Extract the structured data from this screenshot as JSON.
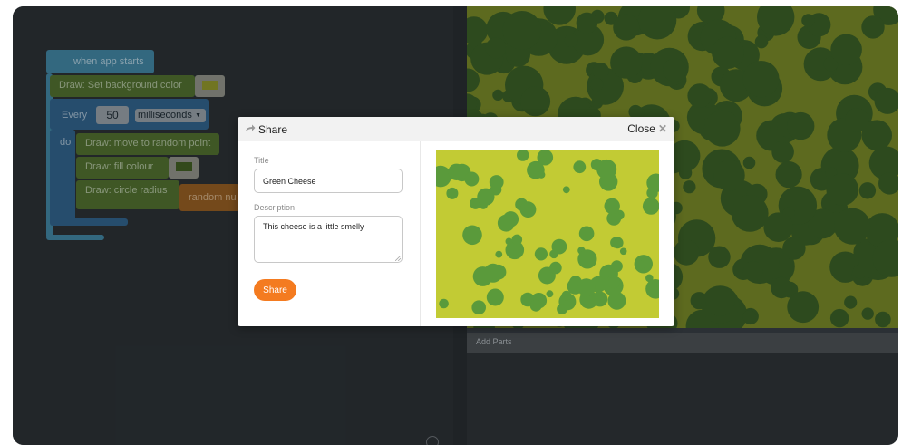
{
  "workspace": {
    "blocks": {
      "event": "when app starts",
      "set_bg": "Draw: Set background color",
      "every_label": "Every",
      "every_value": "50",
      "every_unit": "milliseconds",
      "do_label": "do",
      "move": "Draw: move to random point",
      "fill": "Draw: fill colour",
      "circle": "Draw: circle radius",
      "random": "random nu"
    },
    "swatch_colors": {
      "set_bg": "#8a8f2a",
      "fill": "#3d5a22"
    }
  },
  "stage": {
    "add_parts_label": "Add Parts",
    "bg_color": "#5d6a1f",
    "circle_color": "#2d4a1e"
  },
  "modal": {
    "title": "Share",
    "close_label": "Close",
    "title_label": "Title",
    "title_value": "Green Cheese",
    "description_label": "Description",
    "description_value": "This cheese is a little smelly",
    "share_button": "Share",
    "preview_bg": "#c2cb34",
    "preview_circle_color": "#5a9a3b",
    "accent": "#f47b20"
  },
  "icons": [
    "share-arrow-icon",
    "close-icon",
    "dropdown-arrow-icon",
    "resize-grip-icon",
    "scroll-knob-icon"
  ]
}
